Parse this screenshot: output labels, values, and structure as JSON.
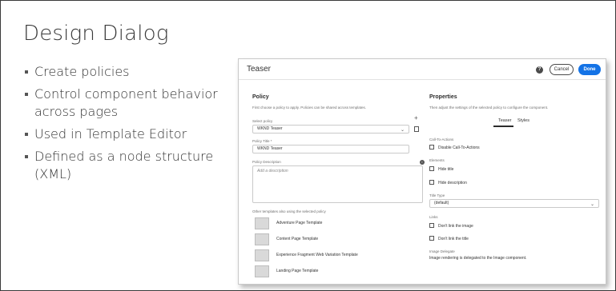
{
  "slide": {
    "title": "Design Dialog",
    "bullets": [
      "Create policies",
      "Control component behavior across pages",
      "Used in Template Editor",
      "Defined as a node structure (XML)"
    ]
  },
  "dialog": {
    "title": "Teaser",
    "cancel_label": "Cancel",
    "done_label": "Done",
    "accent_color": "#1473e6",
    "policy": {
      "heading": "Policy",
      "description": "First choose a policy to apply. Policies can be shared across templates.",
      "select_label": "Select policy",
      "select_value": "WKND Teaser",
      "title_label": "Policy Title *",
      "title_value": "WKND Teaser",
      "desc_label": "Policy Description",
      "desc_placeholder": "Add a description",
      "other_templates_label": "Other templates also using the selected policy",
      "templates": [
        "Adventure Page Template",
        "Content Page Template",
        "Experience Fragment Web Variation Template",
        "Landing Page Template"
      ]
    },
    "properties": {
      "heading": "Properties",
      "description": "Then adjust the settings of the selected policy to configure the component.",
      "tabs": [
        "Teaser",
        "Styles"
      ],
      "call_to_actions_label": "Call-To-Actions",
      "disable_cta": "Disable Call-To-Actions",
      "elements_label": "Elements",
      "hide_title": "Hide title",
      "hide_description": "Hide description",
      "title_type_label": "Title Type",
      "title_type_value": "(default)",
      "links_label": "Links",
      "dont_link_image": "Don't link the image",
      "dont_link_title": "Don't link the title",
      "image_delegate_label": "Image Delegate",
      "image_delegate_text": "Image rendering is delegated to the Image component."
    }
  }
}
